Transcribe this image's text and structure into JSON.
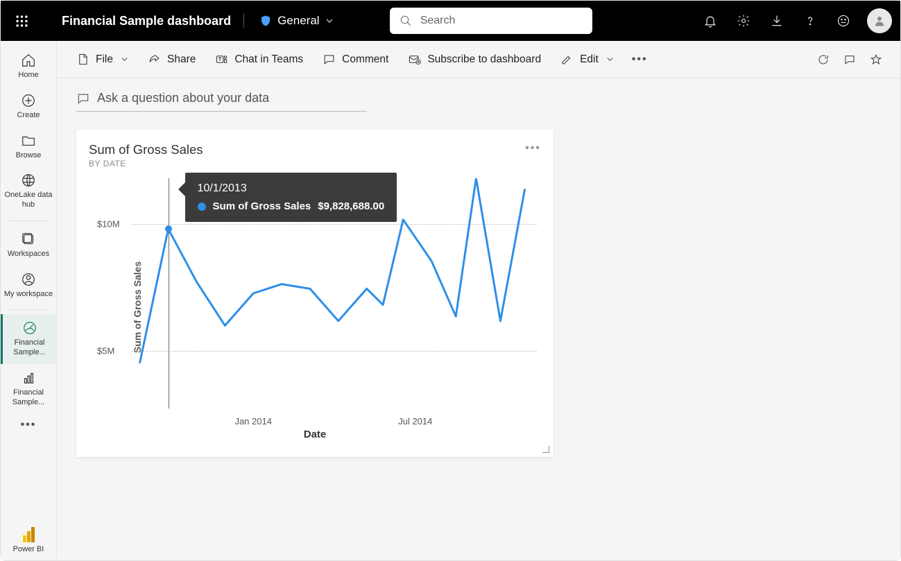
{
  "header": {
    "title": "Financial Sample dashboard",
    "sensitivity": "General",
    "search_placeholder": "Search"
  },
  "nav": {
    "home": "Home",
    "create": "Create",
    "browse": "Browse",
    "onelake": "OneLake data hub",
    "workspaces": "Workspaces",
    "myworkspace": "My workspace",
    "item1": "Financial Sample...",
    "item2": "Financial Sample...",
    "brand": "Power BI"
  },
  "toolbar": {
    "file": "File",
    "share": "Share",
    "chat": "Chat in Teams",
    "comment": "Comment",
    "subscribe": "Subscribe to dashboard",
    "edit": "Edit"
  },
  "qna_placeholder": "Ask a question about your data",
  "tile": {
    "title": "Sum of Gross Sales",
    "subtitle": "BY DATE"
  },
  "tooltip": {
    "date": "10/1/2013",
    "label": "Sum of Gross Sales",
    "value": "$9,828,688.00"
  },
  "chart_data": {
    "type": "line",
    "xlabel": "Date",
    "ylabel": "Sum of Gross Sales",
    "y_ticks": [
      "$5M",
      "$10M"
    ],
    "x_ticks": [
      "Jan 2014",
      "Jul 2014"
    ],
    "ylim": [
      4000000,
      13000000
    ],
    "x": [
      "2013-09",
      "2013-10",
      "2013-11",
      "2013-12",
      "2014-01",
      "2014-02",
      "2014-03",
      "2014-04",
      "2014-05",
      "2014-06",
      "2014-07",
      "2014-08",
      "2014-09",
      "2014-10",
      "2014-11",
      "2014-12"
    ],
    "series": [
      {
        "name": "Sum of Gross Sales",
        "values": [
          4700000,
          9830000,
          7800000,
          6000000,
          7200000,
          7600000,
          7400000,
          6200000,
          7400000,
          6800000,
          10200000,
          8700000,
          6300000,
          12800000,
          6100000,
          12200000
        ]
      }
    ]
  }
}
